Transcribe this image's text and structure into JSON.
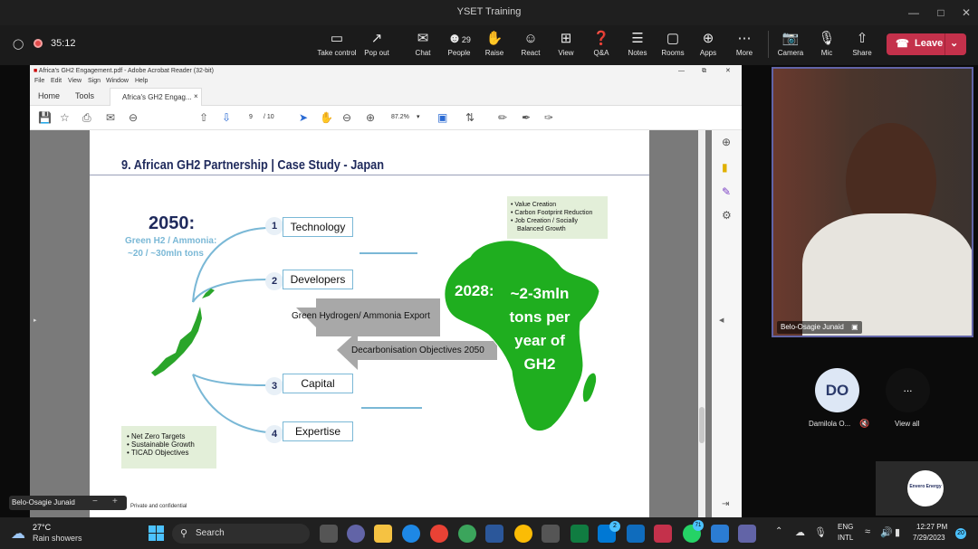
{
  "window": {
    "title": "YSET Training"
  },
  "toolbar": {
    "timer": "35:12",
    "items": [
      {
        "label": "Take control",
        "icon": "take-control-icon"
      },
      {
        "label": "Pop out",
        "icon": "pop-out-icon"
      },
      {
        "label": "Chat",
        "icon": "chat-icon"
      },
      {
        "label": "People",
        "icon": "people-icon",
        "count": "29"
      },
      {
        "label": "Raise",
        "icon": "raise-hand-icon"
      },
      {
        "label": "React",
        "icon": "react-icon"
      },
      {
        "label": "View",
        "icon": "view-icon"
      },
      {
        "label": "Q&A",
        "icon": "qa-icon"
      },
      {
        "label": "Notes",
        "icon": "notes-icon"
      },
      {
        "label": "Rooms",
        "icon": "rooms-icon"
      },
      {
        "label": "Apps",
        "icon": "apps-icon"
      },
      {
        "label": "More",
        "icon": "more-icon"
      },
      {
        "label": "Camera",
        "icon": "camera-off-icon"
      },
      {
        "label": "Mic",
        "icon": "mic-off-icon"
      },
      {
        "label": "Share",
        "icon": "share-icon"
      }
    ],
    "leave_label": "Leave"
  },
  "acrobat": {
    "title": "Africa's GH2 Engagement.pdf - Adobe Acrobat Reader (32-bit)",
    "menu": [
      "File",
      "Edit",
      "View",
      "Sign",
      "Window",
      "Help"
    ],
    "tabs": [
      "Home",
      "Tools",
      "Africa's GH2 Engag..."
    ],
    "page_current": "9",
    "page_total": "/ 10",
    "zoom": "87.2%"
  },
  "slide": {
    "title": "9. African GH2 Partnership | Case Study - Japan",
    "year_2050": "2050:",
    "green_h2": "Green H2 / Ammonia:",
    "tons_2050": "~20 / ~30mln tons",
    "items": [
      {
        "num": "1",
        "label": "Technology"
      },
      {
        "num": "2",
        "label": "Developers"
      },
      {
        "num": "3",
        "label": "Capital"
      },
      {
        "num": "4",
        "label": "Expertise"
      }
    ],
    "value_box": [
      "Value Creation",
      "Carbon Footprint Reduction",
      "Job Creation / Socially",
      "Balanced Growth"
    ],
    "export_arrow": "Green Hydrogen/ Ammonia Export",
    "decarb_arrow": "Decarbonisation Objectives 2050",
    "africa_2028": "2028:",
    "africa_text": [
      "~2-3mln",
      "tons per",
      "year of",
      "GH2"
    ],
    "targets": [
      "Net Zero Targets",
      "Sustainable Growth",
      "TICAD Objectives"
    ],
    "footer": "Private and confidential"
  },
  "video": {
    "name": "Belo-Osagie Junaid"
  },
  "presenter_label": "Belo-Osagie Junaid",
  "participants": [
    {
      "initials": "DO",
      "name": "Damilola O..."
    },
    {
      "initials": "...",
      "name": "View all"
    }
  ],
  "energy_logo": "Envero Energy",
  "taskbar": {
    "weather_temp": "27°C",
    "weather_desc": "Rain showers",
    "search_placeholder": "Search",
    "lang1": "ENG",
    "lang2": "INTL",
    "time": "12:27 PM",
    "date": "7/29/2023",
    "notif": "20",
    "badge_whatsapp": "71",
    "badge_mail": "2"
  },
  "colors": {
    "accent": "#6264a7",
    "leave": "#c4314b",
    "slide_title": "#1f2a5c",
    "africa_green": "#1fae1f",
    "light_blue": "#7ab8d6"
  }
}
